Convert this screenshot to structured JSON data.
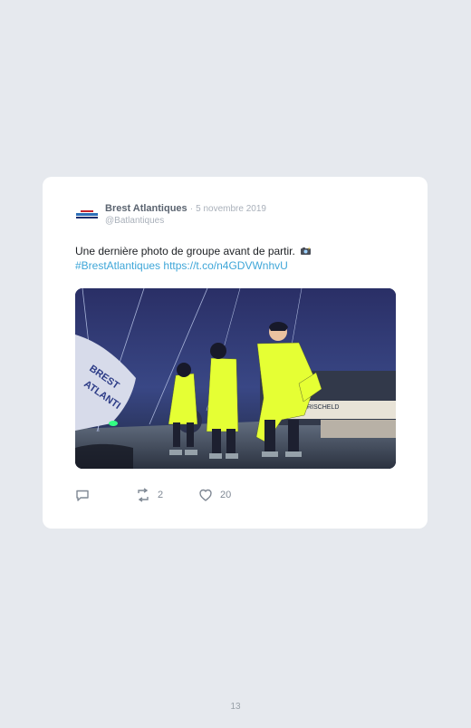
{
  "tweet": {
    "author_name": "Brest Atlantiques",
    "separator": "·",
    "date": "5 novembre 2019",
    "handle": "@Batlantiques",
    "text_line1": "Une dernière photo de groupe avant de partir.",
    "camera_icon": "camera-flash-icon",
    "hashtag": "#BrestAtlantiques",
    "link": "https://t.co/n4GDVWnhvU",
    "photo_icon": "group-photo-image",
    "replies": "",
    "retweets": "2",
    "likes": "20"
  },
  "page_number": "13",
  "colors": {
    "background": "#e6e9ee",
    "card": "#ffffff",
    "link": "#3ea6d8",
    "muted": "#a9b0ba"
  }
}
